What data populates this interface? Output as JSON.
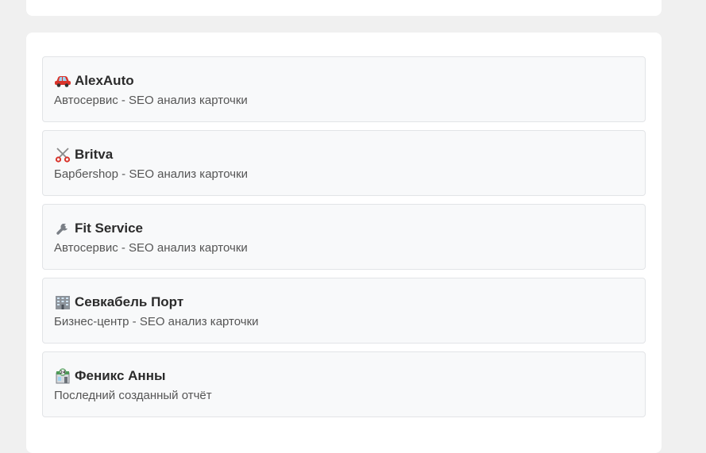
{
  "reports": [
    {
      "icon": "car-icon",
      "title": "AlexAuto",
      "subtitle": "Автосервис - SEO анализ карточки"
    },
    {
      "icon": "scissors-icon",
      "title": "Britva",
      "subtitle": "Барбershop - SEO анализ карточки"
    },
    {
      "icon": "wrench-icon",
      "title": "Fit Service",
      "subtitle": "Автосервис - SEO анализ карточки"
    },
    {
      "icon": "office-building-icon",
      "title": "Севкабель Порт",
      "subtitle": "Бизнес-центр - SEO анализ карточки"
    },
    {
      "icon": "convenience-store-icon",
      "title": "Феникс Анны",
      "subtitle": "Последний созданный отчёт"
    }
  ]
}
